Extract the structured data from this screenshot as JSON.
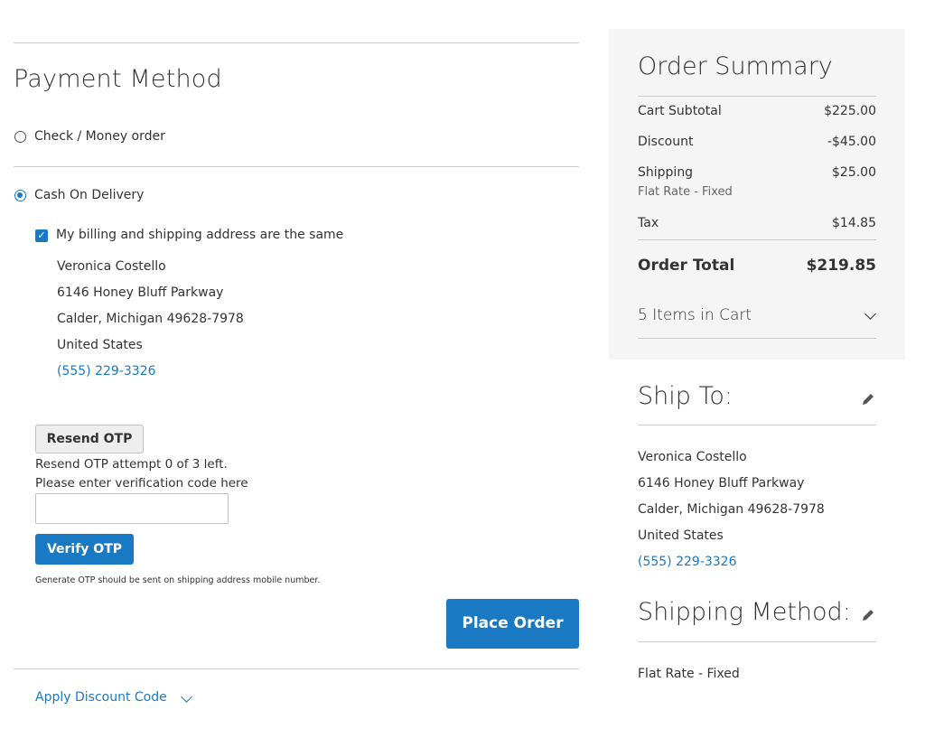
{
  "payment": {
    "title": "Payment Method",
    "options": [
      {
        "label": "Check / Money order",
        "selected": false
      },
      {
        "label": "Cash On Delivery",
        "selected": true
      }
    ],
    "same_address_label": "My billing and shipping address are the same",
    "same_address_checked": true,
    "billing_address": {
      "name": "Veronica Costello",
      "street": "6146 Honey Bluff Parkway",
      "city_line": "Calder, Michigan 49628-7978",
      "country": "United States",
      "phone": "(555) 229-3326"
    },
    "otp": {
      "resend_label": "Resend OTP",
      "attempt_text": "Resend OTP attempt 0 of 3 left.",
      "prompt_text": "Please enter verification code here",
      "input_value": "",
      "verify_label": "Verify OTP",
      "note": "Generate OTP should be sent on shipping address mobile number."
    },
    "place_order_label": "Place Order",
    "discount_label": "Apply Discount Code"
  },
  "summary": {
    "title": "Order Summary",
    "rows": [
      {
        "label": "Cart Subtotal",
        "value": "$225.00"
      },
      {
        "label": "Discount",
        "value": "-$45.00"
      },
      {
        "label": "Shipping",
        "value": "$25.00",
        "sub": "Flat Rate - Fixed"
      },
      {
        "label": "Tax",
        "value": "$14.85"
      }
    ],
    "total_label": "Order Total",
    "total_value": "$219.85",
    "items_label": "5 Items in Cart"
  },
  "ship_to": {
    "title": "Ship To:",
    "name": "Veronica Costello",
    "street": "6146 Honey Bluff Parkway",
    "city_line": "Calder, Michigan 49628-7978",
    "country": "United States",
    "phone": "(555) 229-3326"
  },
  "shipping_method": {
    "title": "Shipping Method:",
    "value": "Flat Rate - Fixed"
  },
  "colors": {
    "accent": "#1979c3",
    "summary_bg": "#f5f5f5"
  }
}
